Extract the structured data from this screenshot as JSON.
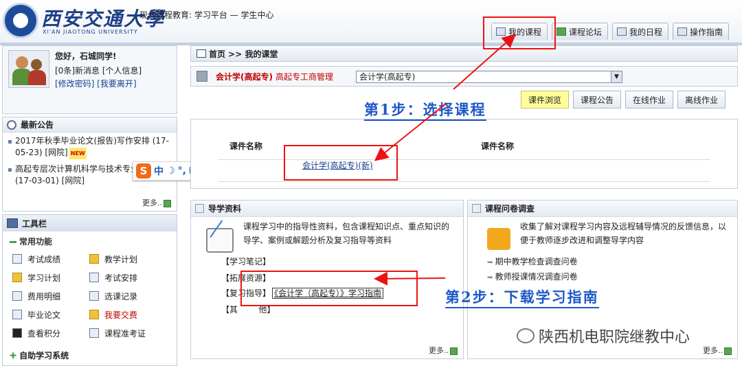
{
  "header": {
    "school_cn": "西安交通大學",
    "school_en": "XI'AN JIAOTONG UNIVERSITY",
    "subtitle": "现代远程教育: 学习平台 — 学生中心",
    "tabs": [
      {
        "label": "我的课程",
        "icon": "home-icon"
      },
      {
        "label": "课程论坛",
        "icon": "forum-icon"
      },
      {
        "label": "我的日程",
        "icon": "calendar-icon"
      },
      {
        "label": "操作指南",
        "icon": "book-icon"
      }
    ]
  },
  "user": {
    "greeting": "您好，石城同学!",
    "messages": "[0条]新消息 [个人信息]",
    "links": "[修改密码]  [我要离开]"
  },
  "notice": {
    "title": "最新公告",
    "items": [
      {
        "text": "2017年秋季毕业论文(报告)写作安排 (17-05-23) [网院]",
        "badge": "NEW"
      },
      {
        "text": "高起专层次计算机科学与技术专业选课 (17-03-01) [网院]"
      }
    ],
    "more": "更多.."
  },
  "ime": {
    "logo": "S",
    "mode": "中",
    "symbols": [
      "☽",
      "°,",
      "⌨",
      "👤",
      "👕",
      "🔧"
    ]
  },
  "toolbar": {
    "title": "工具栏",
    "section": "常用功能",
    "items": [
      [
        "考试成绩",
        "教学计划"
      ],
      [
        "学习计划",
        "考试安排"
      ],
      [
        "费用明细",
        "选课记录"
      ],
      [
        "毕业论文",
        "我要交费"
      ],
      [
        "查看积分",
        "课程准考证"
      ]
    ],
    "self_study": "自助学习系统"
  },
  "breadcrumb": "首页 >> 我的课堂",
  "course_bar": {
    "course": "会计学(高起专)",
    "major": "高起专工商管理",
    "selected": "会计学(高起专)"
  },
  "tabs2": [
    "课件浏览",
    "课程公告",
    "在线作业",
    "离线作业"
  ],
  "courseware": {
    "col1": "课件名称",
    "col2": "课件名称",
    "link": "会计学(高起专)(新)"
  },
  "guide": {
    "title": "导学资料",
    "desc": "课程学习中的指导性资料，包含课程知识点、重点知识的导学、案例或解题分析及复习指导等资料",
    "items": [
      "【学习笔记】",
      "【拓展资源】",
      "【复习指导】",
      "【其        他】"
    ],
    "guide_link": "《会计学（高起专）》学习指南",
    "more": "更多.."
  },
  "survey": {
    "title": "课程问卷调查",
    "desc": "收集了解对课程学习内容及远程辅导情况的反馈信息，以便于教师逐步改进和调整导学内容",
    "items": [
      "期中教学检查调查问卷",
      "教师授课情况调查问卷"
    ],
    "more": "更多.."
  },
  "annotations": {
    "step1": "第1步：选择课程",
    "step2": "第2步：下载学习指南"
  },
  "watermark": "陕西机电职院继教中心",
  "colors": {
    "annotation_red": "#e11111",
    "annotation_blue": "#1e58c8",
    "course_red": "#c00000"
  }
}
